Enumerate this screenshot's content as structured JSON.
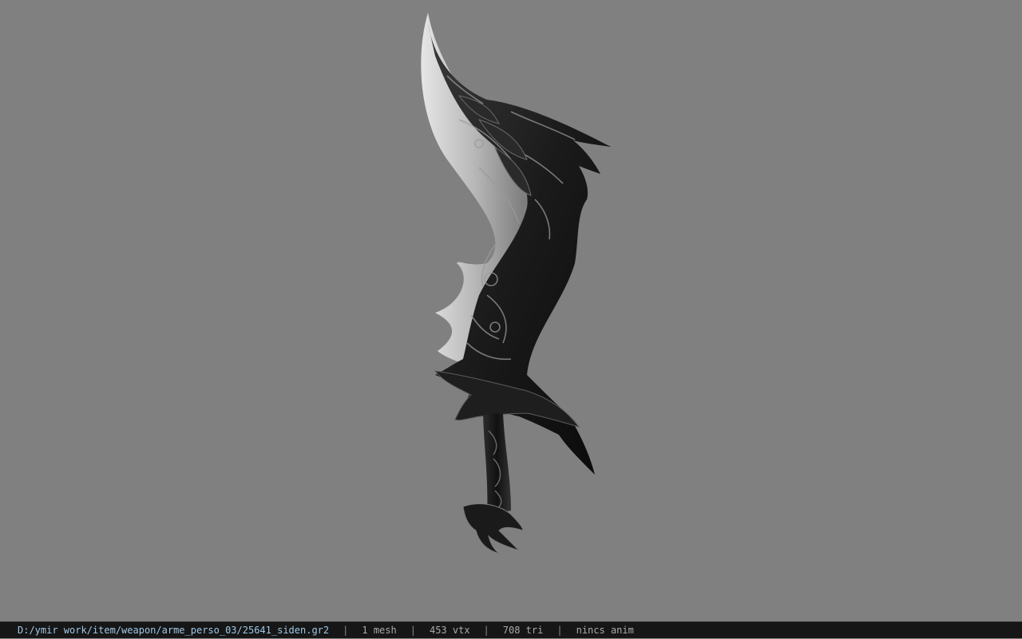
{
  "viewport": {
    "background_color": "#808080",
    "model_icon": "curved-sword-model"
  },
  "statusbar": {
    "file_path": "D:/ymir work/item/weapon/arme_perso_03/25641_siden.gr2",
    "separator": "|",
    "mesh_count": "1 mesh",
    "vertex_count": "453 vtx",
    "triangle_count": "708 tri",
    "anim_status": "nincs anim"
  }
}
